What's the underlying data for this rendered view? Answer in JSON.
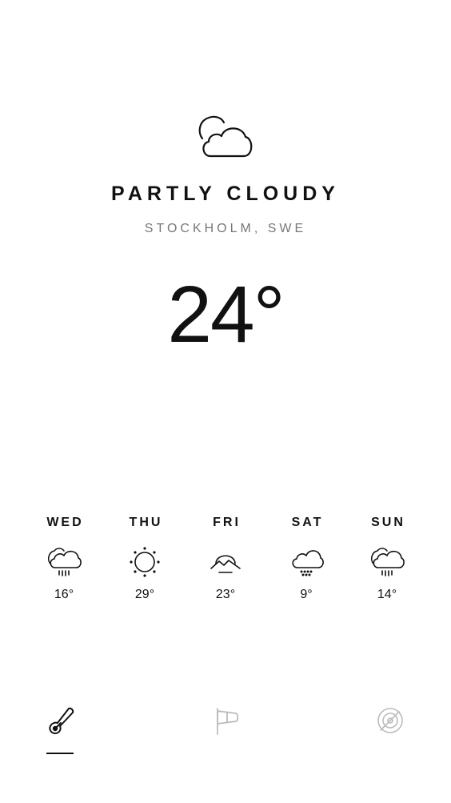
{
  "current": {
    "icon": "partly-cloudy-icon",
    "condition": "PARTLY CLOUDY",
    "location": "STOCKHOLM, SWE",
    "temperature": "24°"
  },
  "forecast": [
    {
      "day": "WED",
      "icon": "cloud-rain-icon",
      "temp": "16°"
    },
    {
      "day": "THU",
      "icon": "sun-icon",
      "temp": "29°"
    },
    {
      "day": "FRI",
      "icon": "sunset-icon",
      "temp": "23°"
    },
    {
      "day": "SAT",
      "icon": "cloud-snow-icon",
      "temp": "9°"
    },
    {
      "day": "SUN",
      "icon": "cloud-rain-icon",
      "temp": "14°"
    }
  ],
  "tabs": [
    {
      "icon": "thermometer-icon",
      "active": true
    },
    {
      "icon": "windsock-icon",
      "active": false
    },
    {
      "icon": "radar-icon",
      "active": false
    }
  ],
  "colors": {
    "text_primary": "#111111",
    "text_secondary": "#777777",
    "tab_inactive": "#bbbbbb",
    "background": "#ffffff"
  }
}
